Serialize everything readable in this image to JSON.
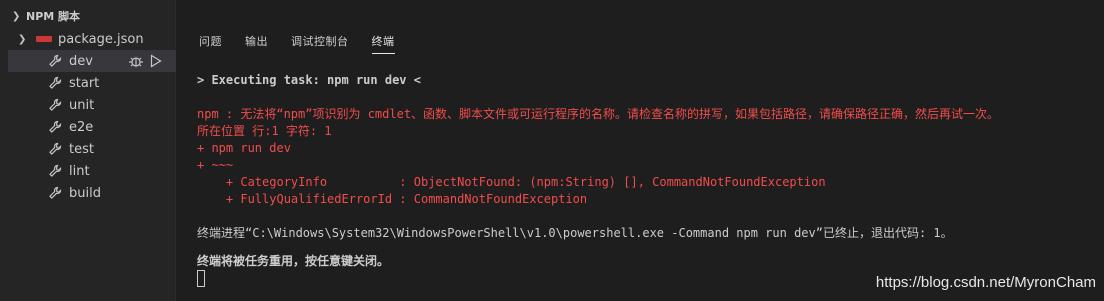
{
  "sidebar": {
    "section_title": "NPM 脚本",
    "package": "package.json",
    "scripts": [
      "dev",
      "start",
      "unit",
      "e2e",
      "test",
      "lint",
      "build"
    ]
  },
  "panel": {
    "tabs": [
      "问题",
      "输出",
      "调试控制台",
      "终端"
    ],
    "active_tab": "终端"
  },
  "terminal": {
    "task_line": "> Executing task: npm run dev <",
    "err_line1": "npm : 无法将“npm”项识别为 cmdlet、函数、脚本文件或可运行程序的名称。请检查名称的拼写，如果包括路径，请确保路径正确，然后再试一次。",
    "err_line2": "所在位置 行:1 字符: 1",
    "err_line3": "+ npm run dev",
    "err_line4": "+ ~~~",
    "err_line5": "    + CategoryInfo          : ObjectNotFound: (npm:String) [], CommandNotFoundException",
    "err_line6": "    + FullyQualifiedErrorId : CommandNotFoundException",
    "exit_line": "终端进程“C:\\Windows\\System32\\WindowsPowerShell\\v1.0\\powershell.exe -Command npm run dev”已终止，退出代码: 1。",
    "reuse_line": "终端将被任务重用，按任意键关闭。"
  },
  "watermark": "https://blog.csdn.net/MyronCham",
  "colors": {
    "error": "#f14c4c",
    "npm_badge": "#cb3837"
  }
}
